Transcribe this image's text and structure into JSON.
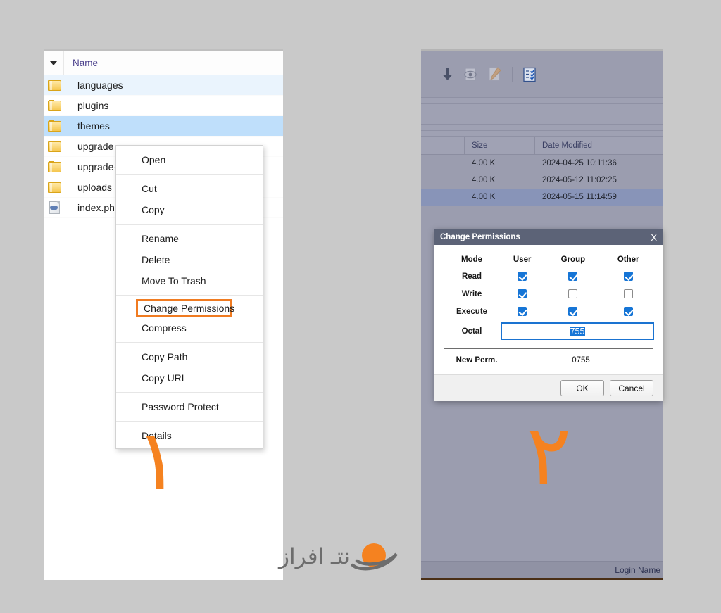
{
  "left_panel": {
    "columns": {
      "sort_caret_icon": "chevron-down-icon",
      "name": "Name"
    },
    "rows": [
      {
        "name": "languages",
        "icon": "folder-icon",
        "state": "hover"
      },
      {
        "name": "plugins",
        "icon": "folder-icon",
        "state": "normal"
      },
      {
        "name": "themes",
        "icon": "folder-icon",
        "state": "selected"
      },
      {
        "name": "upgrade",
        "icon": "folder-icon",
        "state": "normal"
      },
      {
        "name": "upgrade-te",
        "icon": "folder-icon",
        "state": "normal"
      },
      {
        "name": "uploads",
        "icon": "folder-icon",
        "state": "normal"
      },
      {
        "name": "index.php",
        "icon": "php-file-icon",
        "state": "normal"
      }
    ]
  },
  "context_menu": {
    "groups": [
      {
        "items": [
          {
            "label": "Open"
          }
        ]
      },
      {
        "items": [
          {
            "label": "Cut"
          },
          {
            "label": "Copy"
          }
        ]
      },
      {
        "items": [
          {
            "label": "Rename"
          },
          {
            "label": "Delete"
          },
          {
            "label": "Move To Trash"
          }
        ]
      },
      {
        "items": [
          {
            "label": "Change Permissions",
            "highlighted": true
          },
          {
            "label": "Compress"
          }
        ]
      },
      {
        "items": [
          {
            "label": "Copy Path"
          },
          {
            "label": "Copy URL"
          }
        ]
      },
      {
        "items": [
          {
            "label": "Password Protect"
          }
        ]
      },
      {
        "items": [
          {
            "label": "Details"
          }
        ]
      }
    ],
    "highlight_color": "#f07b21"
  },
  "right_panel": {
    "toolbar": [
      {
        "icon": "download-arrow-icon",
        "dimmed": false
      },
      {
        "icon": "eye-view-icon",
        "dimmed": true
      },
      {
        "icon": "pencil-edit-icon",
        "dimmed": true
      },
      {
        "icon": "permissions-checklist-icon",
        "dimmed": false
      }
    ],
    "columns": {
      "blank": "",
      "size": "Size",
      "date_modified": "Date Modified"
    },
    "rows": [
      {
        "size": "4.00 K",
        "date_modified": "2024-04-25 10:11:36",
        "selected": false
      },
      {
        "size": "4.00 K",
        "date_modified": "2024-05-12 11:02:25",
        "selected": false
      },
      {
        "size": "4.00 K",
        "date_modified": "2024-05-15 11:14:59",
        "selected": true
      }
    ],
    "status_bar": {
      "login_name_label": "Login Name"
    }
  },
  "permissions_dialog": {
    "title": "Change Permissions",
    "close_label": "X",
    "title_bar_color": "#5c6377",
    "headers": {
      "mode": "Mode",
      "user": "User",
      "group": "Group",
      "other": "Other"
    },
    "matrix": [
      {
        "mode": "Read",
        "user": true,
        "group": true,
        "other": true
      },
      {
        "mode": "Write",
        "user": true,
        "group": false,
        "other": false
      },
      {
        "mode": "Execute",
        "user": true,
        "group": true,
        "other": true
      }
    ],
    "octal": {
      "label": "Octal",
      "value": "755",
      "selected": true
    },
    "new_perm": {
      "label": "New Perm.",
      "value": "0755"
    },
    "buttons": {
      "ok": "OK",
      "cancel": "Cancel"
    },
    "checkbox_accent": "#1675d6"
  },
  "annotations": [
    {
      "name": "step-1",
      "text": "۱",
      "color": "#f58220"
    },
    {
      "name": "step-2",
      "text": "۲",
      "color": "#f58220"
    }
  ],
  "watermark": {
    "text": "نتـ افراز",
    "planet_color": "#f58220",
    "text_color": "#6d6d6d"
  }
}
